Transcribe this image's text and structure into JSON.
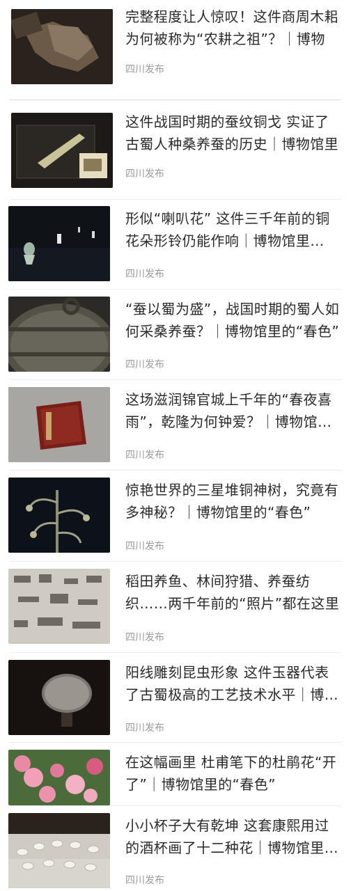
{
  "articles": [
    {
      "title": "完整程度让人惊叹！这件商周木耜为何被称为“农耕之祖”？｜博物",
      "source": "四川发布",
      "thumb_icon": "wooden-plough-artifact"
    },
    {
      "title": "这件战国时期的蚕纹铜戈 实证了古蜀人种桑养蚕的历史｜博物馆里",
      "source": "四川发布",
      "thumb_icon": "bronze-dagger-in-showcase"
    },
    {
      "title": "形似“喇叭花” 这件三千年前的铜花朵形铃仍能作响｜博物馆里的“春色”",
      "source": "四川发布",
      "thumb_icon": "bronze-bell-display"
    },
    {
      "title": "“蚕以蜀为盛”，战国时期的蜀人如何采桑养蚕？｜博物馆里的“春色”",
      "source": "四川发布",
      "thumb_icon": "bronze-pot"
    },
    {
      "title": "这场滋润锦官城上千年的“春夜喜雨”，乾隆为何钟爱？｜博物馆里的“春色”",
      "source": "四川发布",
      "thumb_icon": "red-lacquer-box"
    },
    {
      "title": "惊艳世界的三星堆铜神树，究竟有多神秘？｜博物馆里的“春色”",
      "source": "四川发布",
      "thumb_icon": "bronze-sacred-tree"
    },
    {
      "title": "稻田养鱼、林间狩猎、养蚕纺织……两千年前的“照片”都在这里",
      "source": "四川发布",
      "thumb_icon": "stone-relief-rubbing"
    },
    {
      "title": "阳线雕刻昆虫形象 这件玉器代表了古蜀极高的工艺技术水平｜博物馆里",
      "source": "四川发布",
      "thumb_icon": "jade-disc"
    },
    {
      "title": "在这幅画里 杜甫笔下的杜鹃花“开了”｜博物馆里的“春色”",
      "source": "",
      "thumb_icon": "azalea-flowers"
    },
    {
      "title": "小小杯子大有乾坤 这套康熙用过的酒杯画了十二种花｜博物馆里的“春色”",
      "source": "四川发布",
      "thumb_icon": "porcelain-cups"
    }
  ]
}
